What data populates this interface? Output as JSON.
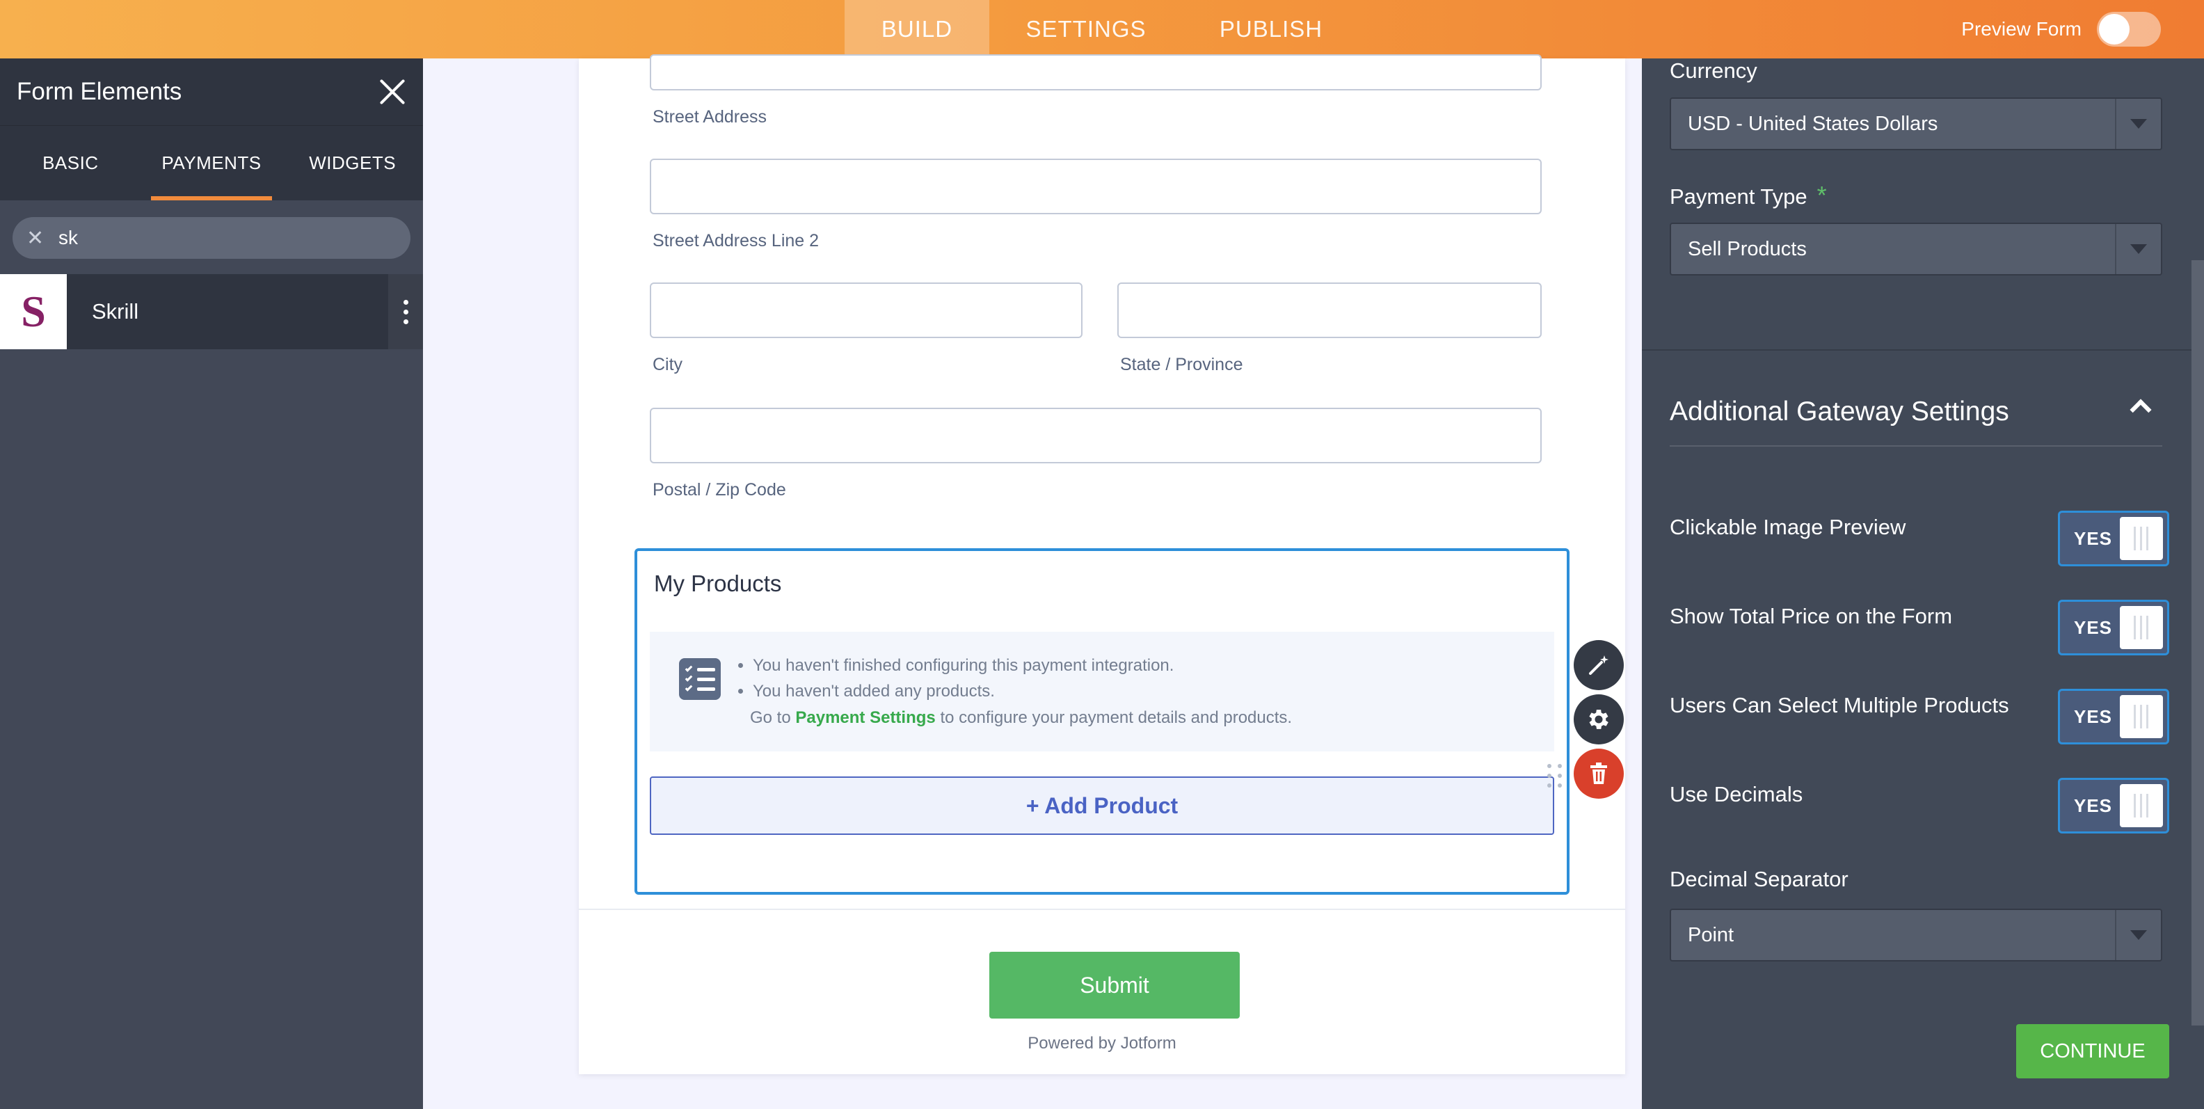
{
  "topbar": {
    "tabs": [
      {
        "label": "BUILD",
        "active": true
      },
      {
        "label": "SETTINGS",
        "active": false
      },
      {
        "label": "PUBLISH",
        "active": false
      }
    ],
    "preview_label": "Preview Form",
    "preview_on": false
  },
  "left_panel": {
    "title": "Form Elements",
    "tabs": [
      {
        "label": "BASIC",
        "active": false
      },
      {
        "label": "PAYMENTS",
        "active": true
      },
      {
        "label": "WIDGETS",
        "active": false
      }
    ],
    "search_value": "sk",
    "elements": [
      {
        "logo": "S",
        "label": "Skrill"
      }
    ]
  },
  "form": {
    "fields": {
      "street": "Street Address",
      "street2": "Street Address Line 2",
      "city": "City",
      "state": "State / Province",
      "postal": "Postal / Zip Code"
    },
    "products": {
      "title": "My Products",
      "notice_items": [
        "You haven't finished configuring this payment integration.",
        "You haven't added any products."
      ],
      "notice_prefix": "Go to",
      "notice_link": "Payment Settings",
      "notice_suffix": "to configure your payment details and products.",
      "add_label": "+ Add Product"
    },
    "submit_label": "Submit",
    "powered_by": "Powered by Jotform"
  },
  "right_panel": {
    "currency_label": "Currency",
    "currency_value": "USD - United States Dollars",
    "payment_type_label": "Payment Type",
    "required_mark": "*",
    "payment_type_value": "Sell Products",
    "section_title": "Additional Gateway Settings",
    "toggles": [
      {
        "label": "Clickable Image Preview",
        "value": "YES"
      },
      {
        "label": "Show Total Price on the Form",
        "value": "YES"
      },
      {
        "label": "Users Can Select Multiple Products",
        "value": "YES"
      },
      {
        "label": "Use Decimals",
        "value": "YES"
      }
    ],
    "decimal_label": "Decimal Separator",
    "decimal_value": "Point",
    "continue_label": "CONTINUE"
  },
  "colors": {
    "accent_orange": "#f28b3c",
    "selection_blue": "#2e8fd9",
    "submit_green": "#55b865",
    "delete_red": "#d9402b"
  }
}
